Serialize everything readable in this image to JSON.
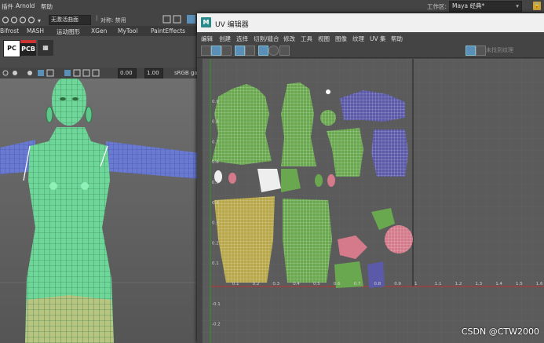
{
  "menubar": {
    "items": [
      "插件",
      "Arnold",
      "帮助"
    ],
    "workspace_label": "工作区:",
    "workspace_value": "Maya 经典*"
  },
  "statusline": {
    "live_surface": "无激活曲面",
    "symmetry": "对称: 禁用"
  },
  "shelf": {
    "tabs": [
      "Bifrost",
      "MASH",
      "运动图形",
      "XGen",
      "MyTool",
      "PaintEffects"
    ],
    "icons": [
      "PC",
      "PCB"
    ]
  },
  "viewport_toolbar": {
    "value_a": "0.00",
    "value_b": "1.00",
    "colorspace": "sRGB ga"
  },
  "uv_editor": {
    "title": "UV 编辑器",
    "menu": [
      "编辑",
      "创建",
      "选择",
      "切割/缝合",
      "修改",
      "工具",
      "视图",
      "图像",
      "纹理",
      "UV 集",
      "帮助"
    ],
    "search_placeholder": "未找到纹理",
    "u_ticks": [
      "0.1",
      "0.2",
      "0.3",
      "0.4",
      "0.5",
      "0.6",
      "0.7",
      "0.8",
      "0.9",
      "1",
      "1.1",
      "1.2",
      "1.3",
      "1.4",
      "1.5",
      "1.6"
    ],
    "v_ticks": [
      "0.1",
      "0.2",
      "0.3",
      "0.4",
      "0.5",
      "0.6",
      "0.7",
      "0.8",
      "0.9",
      "-0.1",
      "-0.2",
      "-0.3"
    ]
  },
  "watermark": "CSDN @CTW2000",
  "colors": {
    "mesh_green": "#6fd69a",
    "uv_green": "#6aa84f",
    "uv_blue": "#5a5aa8",
    "uv_yellow": "#b8a84a",
    "uv_pink": "#d47a8a",
    "uv_red": "#c8503e"
  }
}
